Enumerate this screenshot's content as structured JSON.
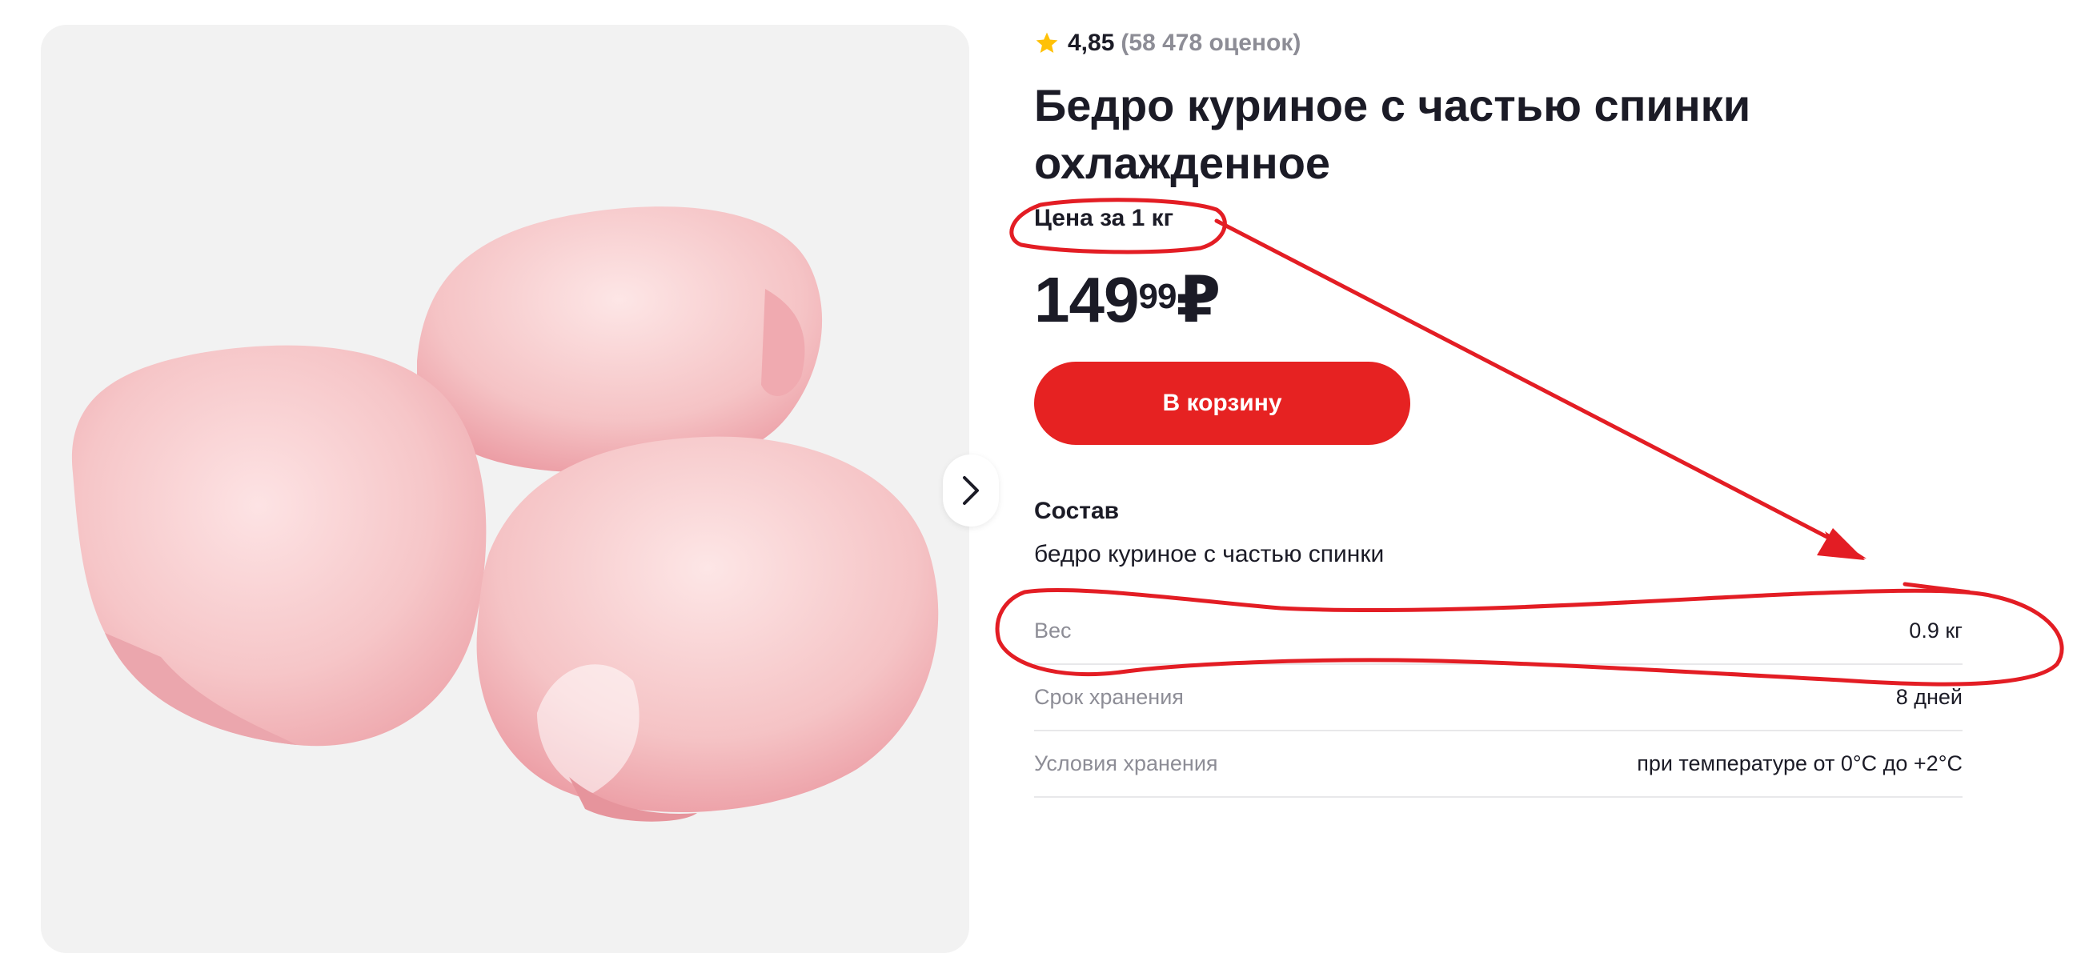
{
  "product": {
    "rating_value": "4,85",
    "rating_count": "(58 478 оценок)",
    "title_line1": "Бедро куриное с частью спинки",
    "title_line2": "охлажденное",
    "unit_label": "Цена за 1 кг",
    "price_int": "149",
    "price_frac": "99",
    "currency": "₽",
    "cart_button_label": "В корзину",
    "composition_heading": "Состав",
    "composition_text": "бедро куриное с частью спинки",
    "specs": [
      {
        "key": "Вес",
        "value": "0.9 кг"
      },
      {
        "key": "Срок хранения",
        "value": "8 дней"
      },
      {
        "key": "Условия хранения",
        "value": "при температуре от 0°C до +2°C"
      }
    ]
  },
  "colors": {
    "accent_red": "#e62222",
    "annotation_red": "#e31d24",
    "star_yellow": "#ffc107",
    "text_dark": "#1b1b26",
    "text_muted": "#8d8d96",
    "image_bg": "#f2f2f2"
  },
  "icons": {
    "rating": "star-icon",
    "gallery_next": "chevron-right-icon"
  }
}
